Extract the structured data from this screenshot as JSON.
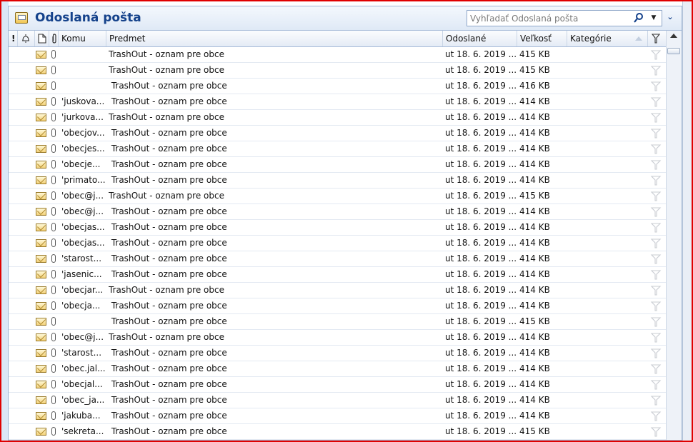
{
  "folder": {
    "title": "Odoslaná pošta",
    "icon": "sent-folder-icon"
  },
  "search": {
    "placeholder": "Vyhľadať Odoslaná pošta",
    "value": "",
    "button_icon": "search-icon",
    "dropdown_icon": "chevron-down-icon",
    "collapse_icon": "double-chevron-down-icon"
  },
  "columns": {
    "importance": "!",
    "reminder_icon": "reminder-bell-icon",
    "type_icon": "document-icon",
    "attachment_icon": "paperclip-icon",
    "to": "Komu",
    "subject": "Predmet",
    "sent": "Odoslané",
    "size": "Veľkosť",
    "categories": "Kategórie",
    "flag_icon": "flag-icon"
  },
  "colors": {
    "title": "#15428b",
    "frame": "#e00000",
    "header_bg": "#e4ebf5"
  },
  "messages": [
    {
      "to": "",
      "subject": "TrashOut - oznam pre obce",
      "sent": "ut 18. 6. 2019 ...",
      "size": "415 KB"
    },
    {
      "to": "",
      "subject": "TrashOut - oznam pre obce",
      "sent": "ut 18. 6. 2019 ...",
      "size": "415 KB"
    },
    {
      "to": "",
      "subject": " TrashOut - oznam pre obce",
      "sent": "ut 18. 6. 2019 ...",
      "size": "416 KB"
    },
    {
      "to": "'juskova...",
      "subject": " TrashOut - oznam pre obce",
      "sent": "ut 18. 6. 2019 ...",
      "size": "414 KB"
    },
    {
      "to": "'jurkova...",
      "subject": "TrashOut - oznam pre obce",
      "sent": "ut 18. 6. 2019 ...",
      "size": "414 KB"
    },
    {
      "to": "'obecjov...",
      "subject": " TrashOut - oznam pre obce",
      "sent": "ut 18. 6. 2019 ...",
      "size": "414 KB"
    },
    {
      "to": "'obecjes...",
      "subject": " TrashOut - oznam pre obce",
      "sent": "ut 18. 6. 2019 ...",
      "size": "414 KB"
    },
    {
      "to": "'obecje...",
      "subject": " TrashOut - oznam pre obce",
      "sent": "ut 18. 6. 2019 ...",
      "size": "414 KB"
    },
    {
      "to": "'primato...",
      "subject": " TrashOut - oznam pre obce",
      "sent": "ut 18. 6. 2019 ...",
      "size": "414 KB"
    },
    {
      "to": "'obec@j...",
      "subject": "TrashOut - oznam pre obce",
      "sent": "ut 18. 6. 2019 ...",
      "size": "415 KB"
    },
    {
      "to": "'obec@j...",
      "subject": " TrashOut - oznam pre obce",
      "sent": "ut 18. 6. 2019 ...",
      "size": "414 KB"
    },
    {
      "to": "'obecjas...",
      "subject": " TrashOut - oznam pre obce",
      "sent": "ut 18. 6. 2019 ...",
      "size": "414 KB"
    },
    {
      "to": "'obecjas...",
      "subject": " TrashOut - oznam pre obce",
      "sent": "ut 18. 6. 2019 ...",
      "size": "414 KB"
    },
    {
      "to": "'starost...",
      "subject": " TrashOut - oznam pre obce",
      "sent": "ut 18. 6. 2019 ...",
      "size": "414 KB"
    },
    {
      "to": "'jasenic...",
      "subject": " TrashOut - oznam pre obce",
      "sent": "ut 18. 6. 2019 ...",
      "size": "414 KB"
    },
    {
      "to": "'obecjar...",
      "subject": "TrashOut - oznam pre obce",
      "sent": "ut 18. 6. 2019 ...",
      "size": "414 KB"
    },
    {
      "to": "'obecja...",
      "subject": " TrashOut - oznam pre obce",
      "sent": "ut 18. 6. 2019 ...",
      "size": "414 KB"
    },
    {
      "to": "",
      "subject": " TrashOut - oznam pre obce",
      "sent": "ut 18. 6. 2019 ...",
      "size": "415 KB"
    },
    {
      "to": "'obec@j...",
      "subject": "TrashOut - oznam pre obce",
      "sent": "ut 18. 6. 2019 ...",
      "size": "414 KB"
    },
    {
      "to": "'starost...",
      "subject": " TrashOut - oznam pre obce",
      "sent": "ut 18. 6. 2019 ...",
      "size": "414 KB"
    },
    {
      "to": "'obec.jal...",
      "subject": " TrashOut - oznam pre obce",
      "sent": "ut 18. 6. 2019 ...",
      "size": "414 KB"
    },
    {
      "to": "'obecjal...",
      "subject": " TrashOut - oznam pre obce",
      "sent": "ut 18. 6. 2019 ...",
      "size": "414 KB"
    },
    {
      "to": "'obec_ja...",
      "subject": " TrashOut - oznam pre obce",
      "sent": "ut 18. 6. 2019 ...",
      "size": "414 KB"
    },
    {
      "to": "'jakuba...",
      "subject": " TrashOut - oznam pre obce",
      "sent": "ut 18. 6. 2019 ...",
      "size": "414 KB"
    },
    {
      "to": "'sekreta...",
      "subject": " TrashOut - oznam pre obce",
      "sent": "ut 18. 6. 2019 ...",
      "size": "415 KB"
    }
  ]
}
